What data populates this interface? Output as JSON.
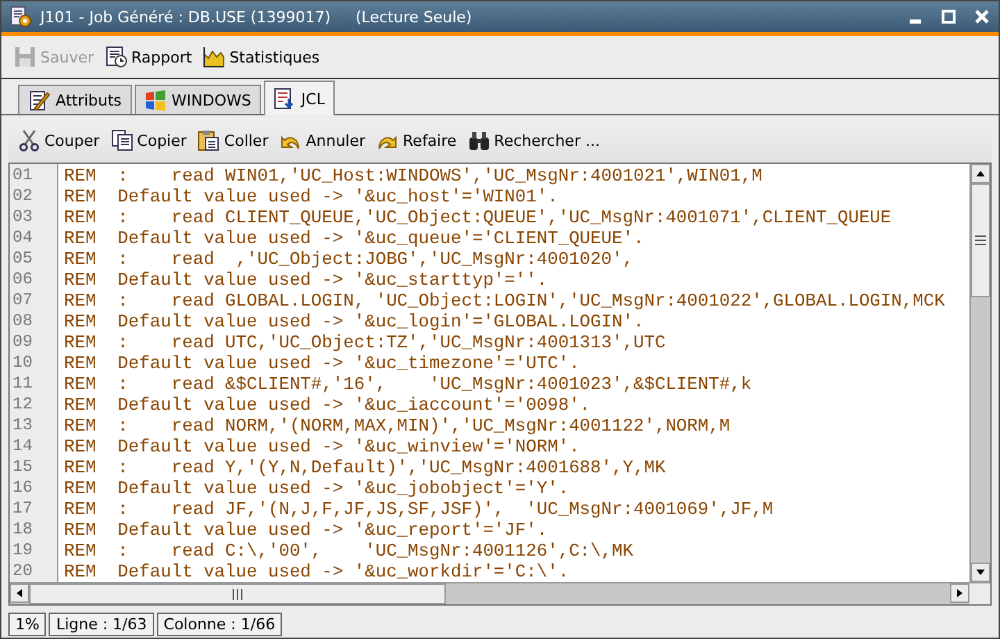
{
  "window": {
    "title": "J101 - Job Généré : DB.USE (1399017)",
    "title_note": "(Lecture Seule)"
  },
  "toolbar": [
    {
      "kind": "save",
      "label": "Sauver",
      "disabled": true
    },
    {
      "kind": "report",
      "label": "Rapport",
      "disabled": false
    },
    {
      "kind": "stats",
      "label": "Statistiques",
      "disabled": false
    }
  ],
  "tabs": [
    {
      "kind": "attributes",
      "label": "Attributs",
      "selected": false
    },
    {
      "kind": "windows",
      "label": "WINDOWS",
      "selected": false
    },
    {
      "kind": "jcl",
      "label": "JCL",
      "selected": true
    }
  ],
  "edit_toolbar": [
    {
      "kind": "cut",
      "label": "Couper"
    },
    {
      "kind": "copy",
      "label": "Copier"
    },
    {
      "kind": "paste",
      "label": "Coller"
    },
    {
      "kind": "undo",
      "label": "Annuler"
    },
    {
      "kind": "redo",
      "label": "Refaire"
    },
    {
      "kind": "find",
      "label": "Rechercher ..."
    }
  ],
  "code": {
    "lines": [
      {
        "number": "01",
        "text": "REM  :    read WIN01,'UC_Host:WINDOWS','UC_MsgNr:4001021',WIN01,M"
      },
      {
        "number": "02",
        "text": "REM  Default value used -> '&uc_host'='WIN01'."
      },
      {
        "number": "03",
        "text": "REM  :    read CLIENT_QUEUE,'UC_Object:QUEUE','UC_MsgNr:4001071',CLIENT_QUEUE"
      },
      {
        "number": "04",
        "text": "REM  Default value used -> '&uc_queue'='CLIENT_QUEUE'."
      },
      {
        "number": "05",
        "text": "REM  :    read  ,'UC_Object:JOBG','UC_MsgNr:4001020',"
      },
      {
        "number": "06",
        "text": "REM  Default value used -> '&uc_starttyp'=''."
      },
      {
        "number": "07",
        "text": "REM  :    read GLOBAL.LOGIN, 'UC_Object:LOGIN','UC_MsgNr:4001022',GLOBAL.LOGIN,MCK"
      },
      {
        "number": "08",
        "text": "REM  Default value used -> '&uc_login'='GLOBAL.LOGIN'."
      },
      {
        "number": "09",
        "text": "REM  :    read UTC,'UC_Object:TZ','UC_MsgNr:4001313',UTC"
      },
      {
        "number": "10",
        "text": "REM  Default value used -> '&uc_timezone'='UTC'."
      },
      {
        "number": "11",
        "text": "REM  :    read &$CLIENT#,'16',    'UC_MsgNr:4001023',&$CLIENT#,k"
      },
      {
        "number": "12",
        "text": "REM  Default value used -> '&uc_iaccount'='0098'."
      },
      {
        "number": "13",
        "text": "REM  :    read NORM,'(NORM,MAX,MIN)','UC_MsgNr:4001122',NORM,M"
      },
      {
        "number": "14",
        "text": "REM  Default value used -> '&uc_winview'='NORM'."
      },
      {
        "number": "15",
        "text": "REM  :    read Y,'(Y,N,Default)','UC_MsgNr:4001688',Y,MK"
      },
      {
        "number": "16",
        "text": "REM  Default value used -> '&uc_jobobject'='Y'."
      },
      {
        "number": "17",
        "text": "REM  :    read JF,'(N,J,F,JF,JS,SF,JSF)',  'UC_MsgNr:4001069',JF,M"
      },
      {
        "number": "18",
        "text": "REM  Default value used -> '&uc_report'='JF'."
      },
      {
        "number": "19",
        "text": "REM  :    read C:\\,'00',    'UC_MsgNr:4001126',C:\\,MK"
      },
      {
        "number": "20",
        "text": "REM  Default value used -> '&uc_workdir'='C:\\'."
      }
    ]
  },
  "status_bar": [
    {
      "text": "1%"
    },
    {
      "text": "Ligne : 1/63"
    },
    {
      "text": "Colonne : 1/66"
    }
  ]
}
